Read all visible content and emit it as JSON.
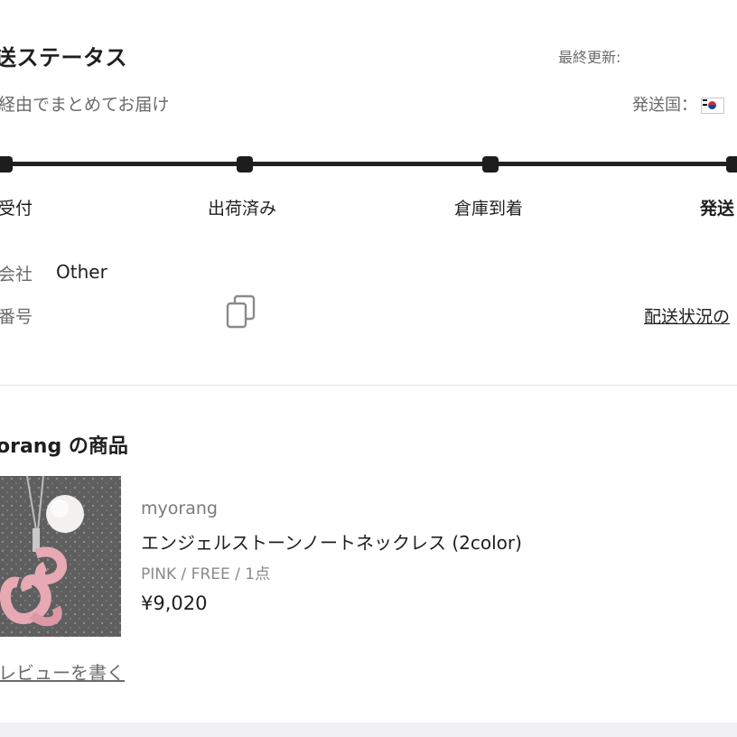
{
  "header": {
    "title": "送ステータス",
    "last_updated_label": "最終更新:",
    "subtitle": "経由でまとめてお届け",
    "ship_country_label": "発送国："
  },
  "progress": {
    "steps": [
      {
        "label": "受付"
      },
      {
        "label": "出荷済み"
      },
      {
        "label": "倉庫到着"
      },
      {
        "label": "発送"
      }
    ]
  },
  "shipping": {
    "carrier_label": "会社",
    "carrier_value": "Other",
    "tracking_label": "番号",
    "tracking_link": "配送状況の"
  },
  "shop": {
    "title": "orang の商品"
  },
  "product": {
    "brand": "myorang",
    "name": "エンジェルストーンノートネックレス (2color)",
    "options": "PINK / FREE / 1点",
    "price": "¥9,020"
  },
  "actions": {
    "review": "レビューを書く"
  },
  "icons": {
    "copy": "copy-icon",
    "flag": "south-korea-flag-icon"
  },
  "colors": {
    "text": "#1f1f1f",
    "muted": "#6b6b6b",
    "track": "#222222"
  }
}
